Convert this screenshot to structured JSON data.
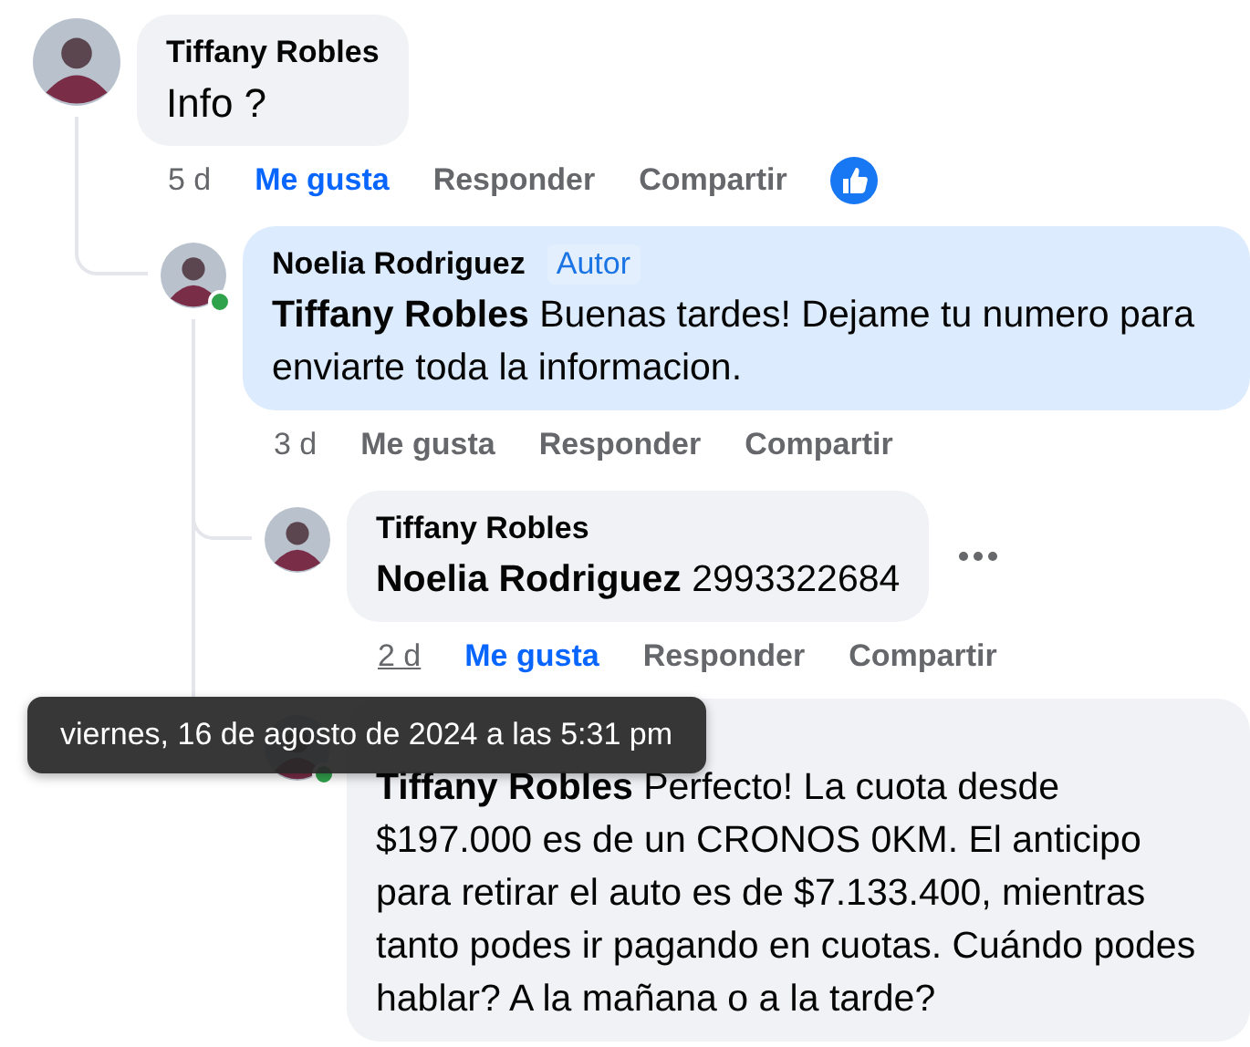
{
  "comments": [
    {
      "author": "Tiffany Robles",
      "body": "Info ?",
      "time": "5 d",
      "actions": [
        {
          "label": "Me gusta",
          "selected": true
        },
        {
          "label": "Responder",
          "selected": false
        },
        {
          "label": "Compartir",
          "selected": false
        }
      ],
      "liked_badge": true,
      "replies": [
        {
          "author": "Noelia Rodriguez",
          "author_badge": "Autor",
          "online": true,
          "highlighted": true,
          "body": "**Tiffany Robles** Buenas tardes! Dejame tu numero para enviarte toda la informacion.",
          "time": "3 d",
          "actions": [
            {
              "label": "Me gusta",
              "selected": false
            },
            {
              "label": "Responder",
              "selected": false
            },
            {
              "label": "Compartir",
              "selected": false
            }
          ],
          "replies": [
            {
              "author": "Tiffany Robles",
              "body": "**Noelia Rodriguez** 2993322684",
              "time": "2 d",
              "time_hovered": true,
              "actions": [
                {
                  "label": "Me gusta",
                  "selected": true
                },
                {
                  "label": "Responder",
                  "selected": false
                },
                {
                  "label": "Compartir",
                  "selected": false
                }
              ],
              "more_menu": true
            },
            {
              "online": true,
              "body": "**Tiffany Robles** Perfecto! La cuota desde $197.000 es de un CRONOS 0KM. El anticipo para retirar el auto es de $7.133.400, mientras tanto podes ir pagando en cuotas. Cuándo podes hablar? A la mañana o a la tarde?"
            }
          ]
        }
      ]
    }
  ],
  "tooltip": {
    "text": "viernes, 16 de agosto de 2024 a las 5:31 pm"
  }
}
